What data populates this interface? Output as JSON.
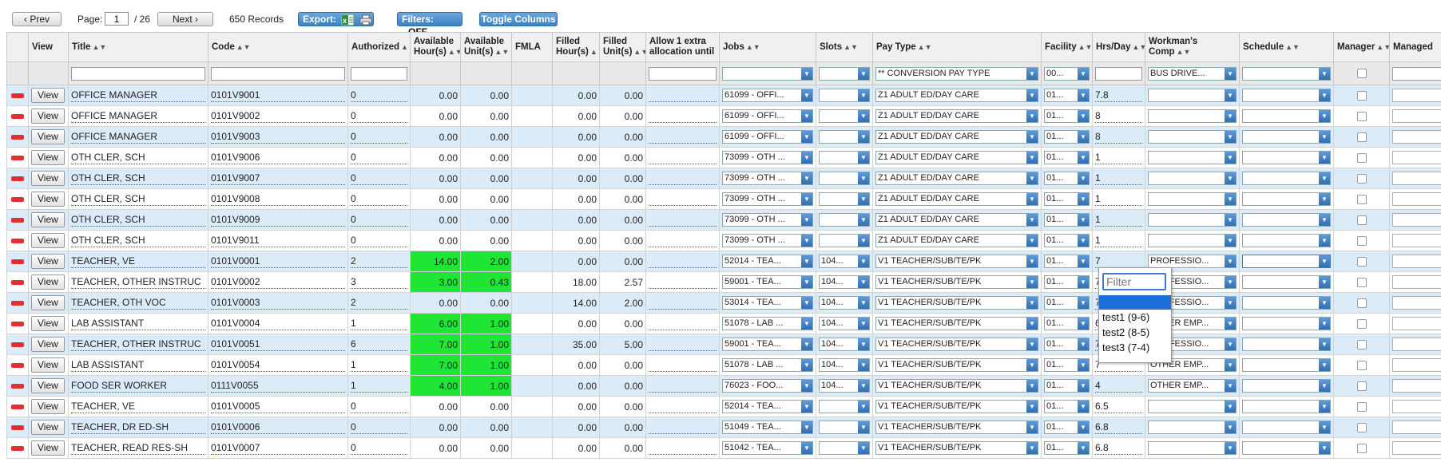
{
  "toolbar": {
    "prev_label": "‹ Prev",
    "page_label": "Page:",
    "page_value": "1",
    "page_total": "/ 26",
    "next_label": "Next ›",
    "records": "650 Records",
    "export_label": "Export:",
    "filters_label": "Filters:",
    "filters_state": "OFF",
    "toggle_columns_label": "Toggle Columns"
  },
  "columns": {
    "view": "View",
    "title": "Title",
    "code": "Code",
    "authorized": "Authorized",
    "available_hours": "Available Hour(s)",
    "available_units": "Available Unit(s)",
    "fmla": "FMLA",
    "filled_hours": "Filled Hour(s)",
    "filled_units": "Filled Unit(s)",
    "allow": "Allow 1 extra allocation until",
    "jobs": "Jobs",
    "slots": "Slots",
    "pay_type": "Pay Type",
    "facility": "Facility",
    "hrs_day": "Hrs/Day",
    "workmans_comp": "Workman's Comp",
    "schedule": "Schedule",
    "manager": "Manager",
    "managed": "Managed"
  },
  "filters": {
    "pay_type": "** CONVERSION PAY TYPE",
    "facility": "00...",
    "workmans_comp": "BUS DRIVE..."
  },
  "view_label": "View",
  "rows": [
    {
      "title": "OFFICE MANAGER",
      "code": "0101V9001",
      "authorized": "0",
      "avail_hours": "0.00",
      "avail_units": "0.00",
      "filled_hours": "0.00",
      "filled_units": "0.00",
      "jobs": "61099 - OFFI...",
      "slots": "",
      "pay_type": "Z1 ADULT ED/DAY CARE",
      "facility": "01...",
      "hrs": "7.8",
      "comp": "",
      "green": false
    },
    {
      "title": "OFFICE MANAGER",
      "code": "0101V9002",
      "authorized": "0",
      "avail_hours": "0.00",
      "avail_units": "0.00",
      "filled_hours": "0.00",
      "filled_units": "0.00",
      "jobs": "61099 - OFFI...",
      "slots": "",
      "pay_type": "Z1 ADULT ED/DAY CARE",
      "facility": "01...",
      "hrs": "8",
      "comp": "",
      "green": false
    },
    {
      "title": "OFFICE MANAGER",
      "code": "0101V9003",
      "authorized": "0",
      "avail_hours": "0.00",
      "avail_units": "0.00",
      "filled_hours": "0.00",
      "filled_units": "0.00",
      "jobs": "61099 - OFFI...",
      "slots": "",
      "pay_type": "Z1 ADULT ED/DAY CARE",
      "facility": "01...",
      "hrs": "8",
      "comp": "",
      "green": false
    },
    {
      "title": "OTH CLER, SCH",
      "code": "0101V9006",
      "authorized": "0",
      "avail_hours": "0.00",
      "avail_units": "0.00",
      "filled_hours": "0.00",
      "filled_units": "0.00",
      "jobs": "73099 - OTH ...",
      "slots": "",
      "pay_type": "Z1 ADULT ED/DAY CARE",
      "facility": "01...",
      "hrs": "1",
      "comp": "",
      "green": false
    },
    {
      "title": "OTH CLER, SCH",
      "code": "0101V9007",
      "authorized": "0",
      "avail_hours": "0.00",
      "avail_units": "0.00",
      "filled_hours": "0.00",
      "filled_units": "0.00",
      "jobs": "73099 - OTH ...",
      "slots": "",
      "pay_type": "Z1 ADULT ED/DAY CARE",
      "facility": "01...",
      "hrs": "1",
      "comp": "",
      "green": false
    },
    {
      "title": "OTH CLER, SCH",
      "code": "0101V9008",
      "authorized": "0",
      "avail_hours": "0.00",
      "avail_units": "0.00",
      "filled_hours": "0.00",
      "filled_units": "0.00",
      "jobs": "73099 - OTH ...",
      "slots": "",
      "pay_type": "Z1 ADULT ED/DAY CARE",
      "facility": "01...",
      "hrs": "1",
      "comp": "",
      "green": false
    },
    {
      "title": "OTH CLER, SCH",
      "code": "0101V9009",
      "authorized": "0",
      "avail_hours": "0.00",
      "avail_units": "0.00",
      "filled_hours": "0.00",
      "filled_units": "0.00",
      "jobs": "73099 - OTH ...",
      "slots": "",
      "pay_type": "Z1 ADULT ED/DAY CARE",
      "facility": "01...",
      "hrs": "1",
      "comp": "",
      "green": false
    },
    {
      "title": "OTH CLER, SCH",
      "code": "0101V9011",
      "authorized": "0",
      "avail_hours": "0.00",
      "avail_units": "0.00",
      "filled_hours": "0.00",
      "filled_units": "0.00",
      "jobs": "73099 - OTH ...",
      "slots": "",
      "pay_type": "Z1 ADULT ED/DAY CARE",
      "facility": "01...",
      "hrs": "1",
      "comp": "",
      "green": false
    },
    {
      "title": "TEACHER, VE",
      "code": "0101V0001",
      "authorized": "2",
      "avail_hours": "14.00",
      "avail_units": "2.00",
      "filled_hours": "0.00",
      "filled_units": "0.00",
      "jobs": "52014 - TEA...",
      "slots": "104...",
      "pay_type": "V1 TEACHER/SUB/TE/PK",
      "facility": "01...",
      "hrs": "7",
      "comp": "PROFESSIO...",
      "green": true
    },
    {
      "title": "TEACHER, OTHER INSTRUC",
      "code": "0101V0002",
      "authorized": "3",
      "avail_hours": "3.00",
      "avail_units": "0.43",
      "filled_hours": "18.00",
      "filled_units": "2.57",
      "jobs": "59001 - TEA...",
      "slots": "104...",
      "pay_type": "V1 TEACHER/SUB/TE/PK",
      "facility": "01...",
      "hrs": "7",
      "comp": "PROFESSIO...",
      "green": true
    },
    {
      "title": "TEACHER, OTH VOC",
      "code": "0101V0003",
      "authorized": "2",
      "avail_hours": "0.00",
      "avail_units": "0.00",
      "filled_hours": "14.00",
      "filled_units": "2.00",
      "jobs": "53014 - TEA...",
      "slots": "104...",
      "pay_type": "V1 TEACHER/SUB/TE/PK",
      "facility": "01...",
      "hrs": "7",
      "comp": "PROFESSIO...",
      "green": false
    },
    {
      "title": "LAB ASSISTANT",
      "code": "0101V0004",
      "authorized": "1",
      "avail_hours": "6.00",
      "avail_units": "1.00",
      "filled_hours": "0.00",
      "filled_units": "0.00",
      "jobs": "51078 - LAB ...",
      "slots": "104...",
      "pay_type": "V1 TEACHER/SUB/TE/PK",
      "facility": "01...",
      "hrs": "6",
      "comp": "OTHER EMP...",
      "green": true
    },
    {
      "title": "TEACHER, OTHER INSTRUC",
      "code": "0101V0051",
      "authorized": "6",
      "avail_hours": "7.00",
      "avail_units": "1.00",
      "filled_hours": "35.00",
      "filled_units": "5.00",
      "jobs": "59001 - TEA...",
      "slots": "104...",
      "pay_type": "V1 TEACHER/SUB/TE/PK",
      "facility": "01...",
      "hrs": "7",
      "comp": "PROFESSIO...",
      "green": true
    },
    {
      "title": "LAB ASSISTANT",
      "code": "0101V0054",
      "authorized": "1",
      "avail_hours": "7.00",
      "avail_units": "1.00",
      "filled_hours": "0.00",
      "filled_units": "0.00",
      "jobs": "51078 - LAB ...",
      "slots": "104...",
      "pay_type": "V1 TEACHER/SUB/TE/PK",
      "facility": "01...",
      "hrs": "7",
      "comp": "OTHER EMP...",
      "green": true
    },
    {
      "title": "FOOD SER WORKER",
      "code": "0111V0055",
      "authorized": "1",
      "avail_hours": "4.00",
      "avail_units": "1.00",
      "filled_hours": "0.00",
      "filled_units": "0.00",
      "jobs": "76023 - FOO...",
      "slots": "104...",
      "pay_type": "V1 TEACHER/SUB/TE/PK",
      "facility": "01...",
      "hrs": "4",
      "comp": "OTHER EMP...",
      "green": true
    },
    {
      "title": "TEACHER, VE",
      "code": "0101V0005",
      "authorized": "0",
      "avail_hours": "0.00",
      "avail_units": "0.00",
      "filled_hours": "0.00",
      "filled_units": "0.00",
      "jobs": "52014 - TEA...",
      "slots": "",
      "pay_type": "V1 TEACHER/SUB/TE/PK",
      "facility": "01...",
      "hrs": "6.5",
      "comp": "",
      "green": false
    },
    {
      "title": "TEACHER, DR ED-SH",
      "code": "0101V0006",
      "authorized": "0",
      "avail_hours": "0.00",
      "avail_units": "0.00",
      "filled_hours": "0.00",
      "filled_units": "0.00",
      "jobs": "51049 - TEA...",
      "slots": "",
      "pay_type": "V1 TEACHER/SUB/TE/PK",
      "facility": "01...",
      "hrs": "6.8",
      "comp": "",
      "green": false
    },
    {
      "title": "TEACHER, READ RES-SH",
      "code": "0101V0007",
      "authorized": "0",
      "avail_hours": "0.00",
      "avail_units": "0.00",
      "filled_hours": "0.00",
      "filled_units": "0.00",
      "jobs": "51042 - TEA...",
      "slots": "",
      "pay_type": "V1 TEACHER/SUB/TE/PK",
      "facility": "01...",
      "hrs": "6.8",
      "comp": "",
      "green": false
    }
  ],
  "open_row_index": 8,
  "schedule_dropdown": {
    "filter_placeholder": "Filter",
    "options": [
      "",
      "test1 (9-6)",
      "test2 (8-5)",
      "test3 (7-4)"
    ]
  },
  "colors": {
    "green_cell": "#1fe634",
    "alt_row": "#dcebf8",
    "accent_blue": "#3d82c5"
  }
}
